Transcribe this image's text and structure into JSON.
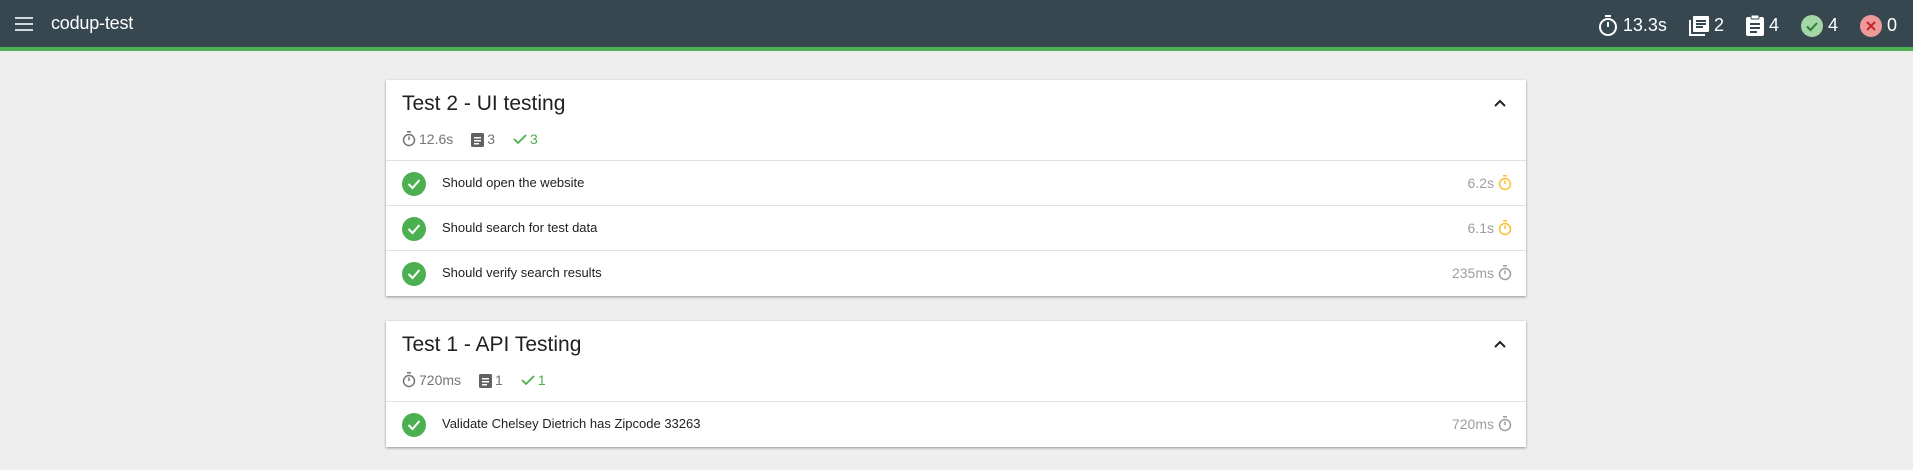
{
  "header": {
    "title": "codup-test",
    "stats": {
      "duration": "13.3s",
      "suites": "2",
      "tests": "4",
      "passes": "4",
      "failures": "0"
    }
  },
  "suites": [
    {
      "title": "Test 2 - UI testing",
      "duration": "12.6s",
      "tests": "3",
      "passes": "3",
      "items": [
        {
          "title": "Should open the website",
          "duration": "6.2s",
          "speed": "slow"
        },
        {
          "title": "Should search for test data",
          "duration": "6.1s",
          "speed": "slow"
        },
        {
          "title": "Should verify search results",
          "duration": "235ms",
          "speed": "fast"
        }
      ]
    },
    {
      "title": "Test 1 - API Testing",
      "duration": "720ms",
      "tests": "1",
      "passes": "1",
      "items": [
        {
          "title": "Validate Chelsey Dietrich has Zipcode 33263",
          "duration": "720ms",
          "speed": "fast"
        }
      ]
    }
  ],
  "colors": {
    "header_bg": "#37474f",
    "accent_pass": "#4caf50",
    "fail": "#f44336",
    "slow_timer": "#fbc02d"
  }
}
